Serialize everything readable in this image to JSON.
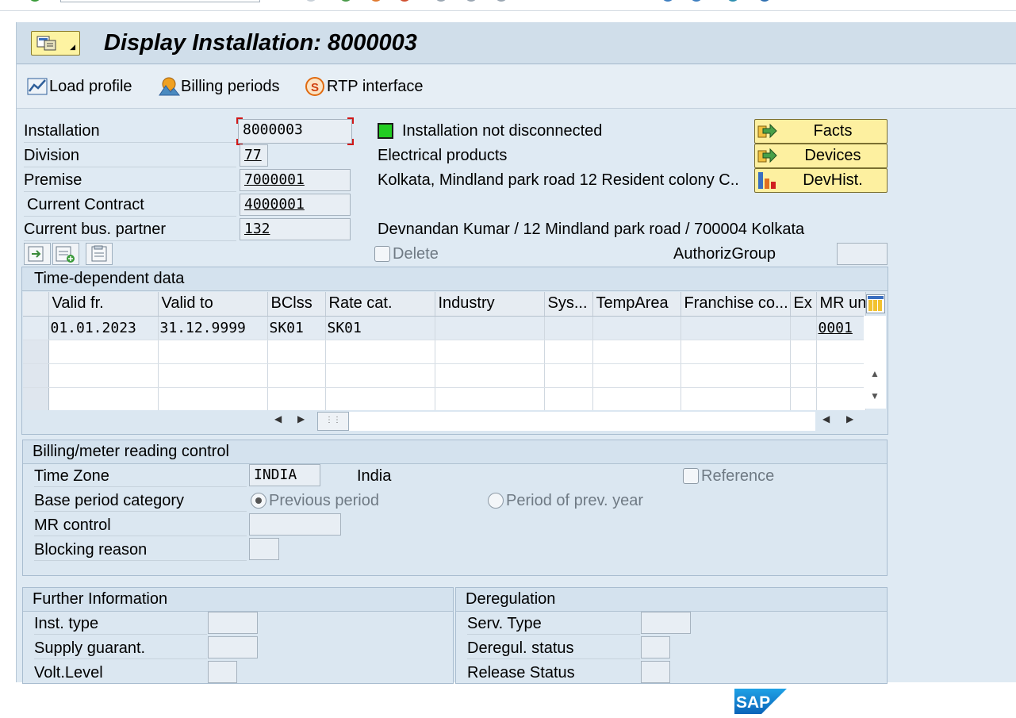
{
  "title": "Display Installation: 8000003",
  "toolbar": {
    "load_profile": "Load profile",
    "billing_periods": "Billing periods",
    "rtp_interface": "RTP interface"
  },
  "header": {
    "installation_label": "Installation",
    "installation_value": "8000003",
    "division_label": "Division",
    "division_value": "77",
    "premise_label": "Premise",
    "premise_value": "7000001",
    "contract_label": "Current Contract",
    "contract_value": "4000001",
    "bp_label": "Current bus. partner",
    "bp_value": "132",
    "status_text": "Installation not disconnected",
    "division_text": "Electrical products",
    "premise_address": "Kolkata, Mindland park road  12  Resident colony  C..",
    "bp_address": "Devnandan Kumar / 12 Mindland park road / 700004 Kolkata",
    "delete_label": "Delete",
    "authgroup_label": "AuthorizGroup",
    "facts_button": "Facts",
    "devices_button": "Devices",
    "devhist_button": "DevHist."
  },
  "timedep": {
    "title": "Time-dependent data",
    "columns": [
      "Valid fr.",
      "Valid to",
      "BClss",
      "Rate cat.",
      "Industry",
      "Sys...",
      "TempArea",
      "Franchise co...",
      "Ex",
      "MR un"
    ],
    "rows": [
      [
        "01.01.2023",
        "31.12.9999",
        "SK01",
        "SK01",
        "",
        "",
        "",
        "",
        "",
        "0001"
      ],
      [
        "",
        "",
        "",
        "",
        "",
        "",
        "",
        "",
        "",
        ""
      ],
      [
        "",
        "",
        "",
        "",
        "",
        "",
        "",
        "",
        "",
        ""
      ],
      [
        "",
        "",
        "",
        "",
        "",
        "",
        "",
        "",
        "",
        ""
      ]
    ]
  },
  "billing": {
    "title": "Billing/meter reading control",
    "timezone_label": "Time Zone",
    "timezone_value": "INDIA",
    "timezone_text": "India",
    "reference_label": "Reference",
    "base_period_label": "Base period category",
    "prev_period": "Previous period",
    "prev_year": "Period of prev. year",
    "mr_control_label": "MR control",
    "blocking_label": "Blocking reason"
  },
  "further": {
    "title": "Further Information",
    "inst_type": "Inst. type",
    "supply": "Supply guarant.",
    "volt": "Volt.Level"
  },
  "dereg": {
    "title": "Deregulation",
    "serv_type": "Serv. Type",
    "status": "Deregul. status",
    "release": "Release Status"
  },
  "brand": "SAP"
}
